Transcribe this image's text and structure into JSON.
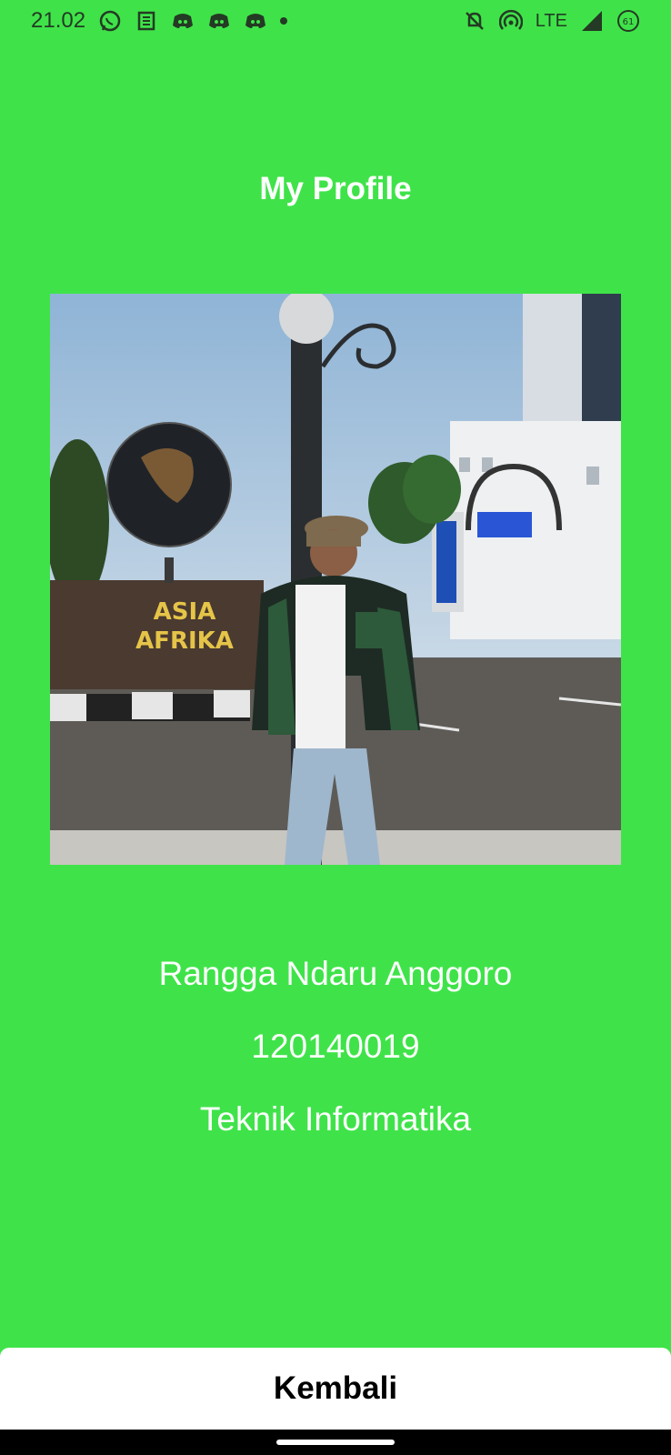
{
  "status_bar": {
    "time": "21.02",
    "network": "LTE",
    "battery": "61",
    "icons": [
      "whatsapp-icon",
      "news-icon",
      "discord-icon",
      "discord-icon",
      "discord-icon",
      "dot-icon",
      "mute-icon",
      "hotspot-icon",
      "signal-icon",
      "battery-icon"
    ]
  },
  "header": {
    "title": "My Profile"
  },
  "profile": {
    "photo_scene_text": "ASIA AFRIKA",
    "name": "Rangga Ndaru Anggoro",
    "nim": "120140019",
    "major": "Teknik Informatika"
  },
  "footer": {
    "back_label": "Kembali"
  },
  "colors": {
    "background": "#3fe349",
    "text": "#ffffff",
    "button": "#ffffff",
    "button_text": "#000000"
  }
}
